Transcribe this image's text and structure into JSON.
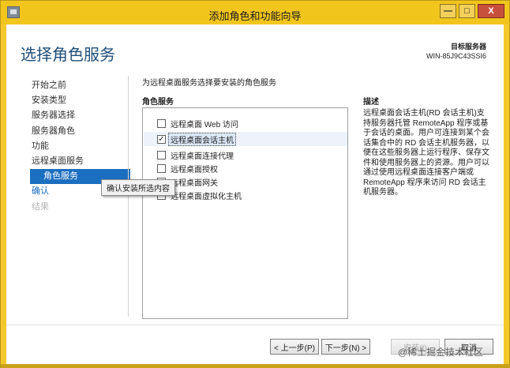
{
  "window": {
    "title": "添加角色和功能向导",
    "buttons": {
      "minimize": "—",
      "maximize": "□",
      "close": "X"
    }
  },
  "page": {
    "title": "选择角色服务",
    "target_label": "目标服务器",
    "target_server": "WIN-85J9C43SSI6"
  },
  "nav": {
    "items": [
      {
        "label": "开始之前",
        "state": "normal"
      },
      {
        "label": "安装类型",
        "state": "normal"
      },
      {
        "label": "服务器选择",
        "state": "normal"
      },
      {
        "label": "服务器角色",
        "state": "normal"
      },
      {
        "label": "功能",
        "state": "normal"
      },
      {
        "label": "远程桌面服务",
        "state": "normal"
      },
      {
        "label": "角色服务",
        "state": "active"
      },
      {
        "label": "确认",
        "state": "link"
      },
      {
        "label": "结果",
        "state": "disabled"
      }
    ]
  },
  "tooltip": {
    "text": "确认安装所选内容"
  },
  "main": {
    "intro": "为远程桌面服务选择要安装的角色服务",
    "roles_heading": "角色服务",
    "roles": [
      {
        "label": "远程桌面 Web 访问",
        "checked": false,
        "check_mark": ""
      },
      {
        "label": "远程桌面会话主机",
        "checked": true,
        "check_mark": "✓"
      },
      {
        "label": "远程桌面连接代理",
        "checked": false,
        "check_mark": ""
      },
      {
        "label": "远程桌面授权",
        "checked": false,
        "check_mark": ""
      },
      {
        "label": "远程桌面网关",
        "checked": false,
        "check_mark": ""
      },
      {
        "label": "远程桌面虚拟化主机",
        "checked": false,
        "check_mark": ""
      }
    ],
    "description_heading": "描述",
    "description": "远程桌面会话主机(RD 会话主机)支持服务器托管 RemoteApp 程序或基于会话的桌面。用户可连接到某个会话集合中的 RD 会话主机服务器，以便在这些服务器上运行程序、保存文件和使用服务器上的资源。用户可以通过使用远程桌面连接客户端或 RemoteApp 程序来访问 RD 会话主机服务器。"
  },
  "footer": {
    "prev": "< 上一步(P)",
    "next": "下一步(N) >",
    "install": "安装(I)",
    "cancel": "取消",
    "watermark": "@稀土掘金技术社区"
  },
  "colors": {
    "titlebar": "#f2c51d",
    "accent": "#1b6fc0",
    "title_text": "#1f4e79"
  }
}
